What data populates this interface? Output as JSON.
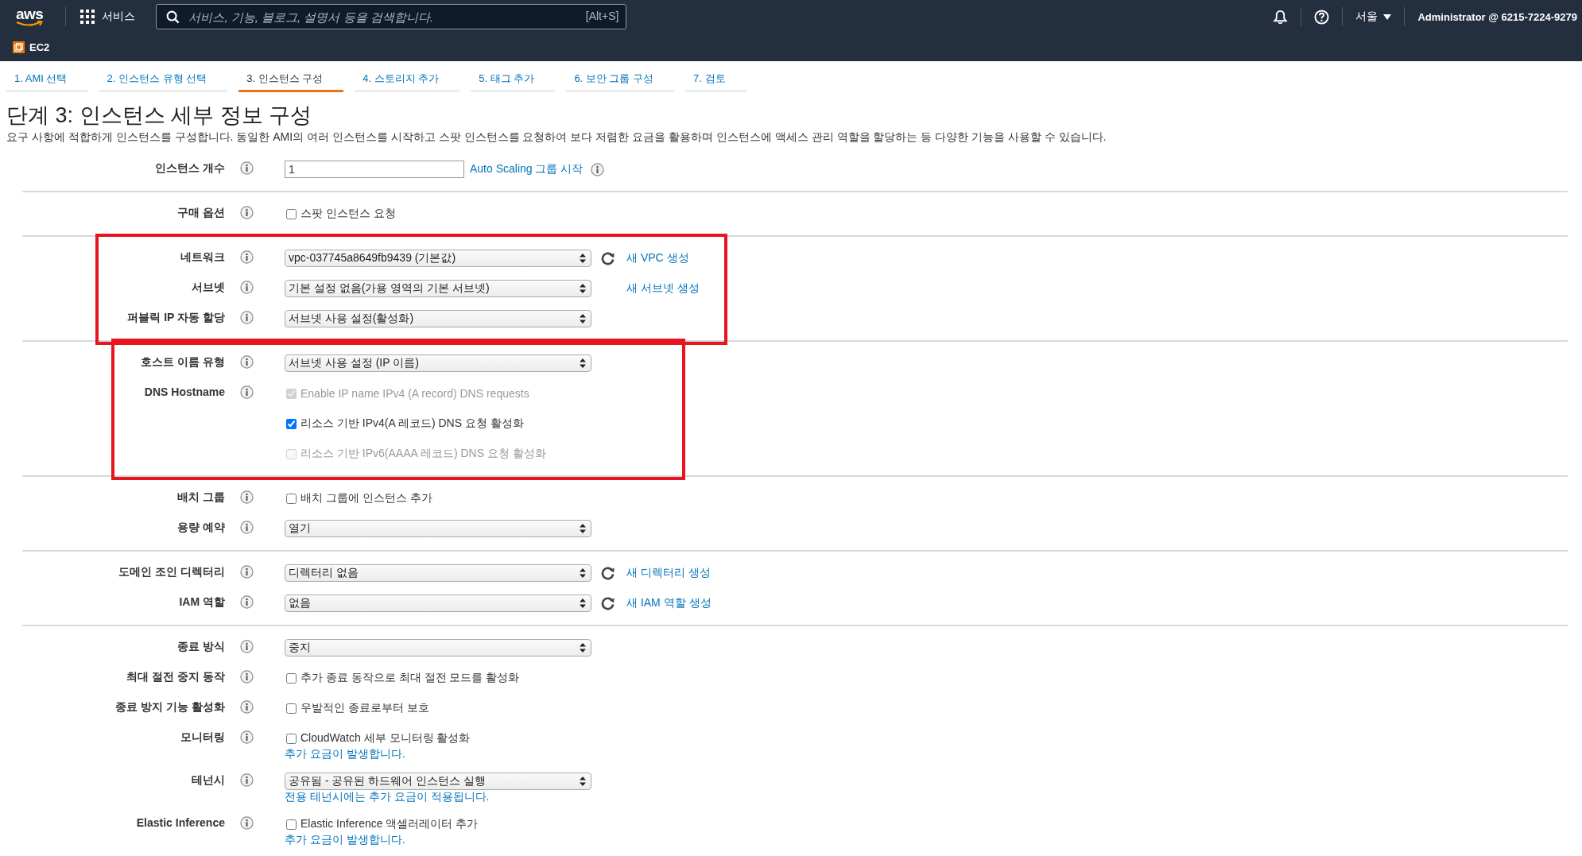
{
  "header": {
    "logo": "aws",
    "services": "서비스",
    "search": {
      "placeholder": "서비스, 기능, 블로그, 설명서 등을 검색합니다.",
      "shortcut": "[Alt+S]"
    },
    "region": "서울",
    "account": "Administrator @ 6215-7224-9279",
    "service": "EC2"
  },
  "tabs": [
    {
      "label": "1. AMI 선택",
      "selected": false
    },
    {
      "label": "2. 인스턴스 유형 선택",
      "selected": false
    },
    {
      "label": "3. 인스턴스 구성",
      "selected": true
    },
    {
      "label": "4. 스토리지 추가",
      "selected": false
    },
    {
      "label": "5. 태그 추가",
      "selected": false
    },
    {
      "label": "6. 보안 그룹 구성",
      "selected": false
    },
    {
      "label": "7. 검토",
      "selected": false
    }
  ],
  "title": "단계 3: 인스턴스 세부 정보 구성",
  "description": "요구 사항에 적합하게 인스턴스를 구성합니다. 동일한 AMI의 여러 인스턴스를 시작하고 스팟 인스턴스를 요청하여 보다 저렴한 요금을 활용하며 인스턴스에 액세스 관리 역할을 할당하는 등 다양한 기능을 사용할 수 있습니다.",
  "sections": [
    {
      "rows": [
        {
          "label": "인스턴스 개수",
          "lines": [
            {
              "kind": "input",
              "value": "1",
              "link": "Auto Scaling 그룹 시작",
              "link_info": true
            }
          ]
        }
      ]
    },
    {
      "rows": [
        {
          "label": "구매 옵션",
          "lines": [
            {
              "kind": "checkbox",
              "text": "스팟 인스턴스 요청",
              "checked": false,
              "disabled": false
            }
          ]
        }
      ]
    },
    {
      "highlighted": true,
      "rows": [
        {
          "label": "네트워크",
          "lines": [
            {
              "kind": "select",
              "value": "vpc-037745a8649fb9439 (기본값)",
              "refresh": true,
              "link": "새 VPC 생성"
            }
          ]
        },
        {
          "label": "서브넷",
          "lines": [
            {
              "kind": "select",
              "value": "기본 설정 없음(가용 영역의 기본 서브넷)",
              "link": "새 서브넷 생성"
            }
          ]
        },
        {
          "label": "퍼블릭 IP 자동 할당",
          "lines": [
            {
              "kind": "select",
              "value": "서브넷 사용 설정(활성화)"
            }
          ]
        }
      ]
    },
    {
      "highlighted": true,
      "rows": [
        {
          "label": "호스트 이름 유형",
          "lines": [
            {
              "kind": "select",
              "value": "서브넷 사용 설정 (IP 이름)"
            }
          ]
        },
        {
          "label": "DNS Hostname",
          "lines": [
            {
              "kind": "checkbox",
              "text": "Enable IP name IPv4 (A record) DNS requests",
              "checked": true,
              "disabled": true
            },
            {
              "kind": "checkbox",
              "text": "리소스 기반 IPv4(A 레코드) DNS 요청 활성화",
              "checked": true,
              "disabled": false
            },
            {
              "kind": "checkbox",
              "text": "리소스 기반 IPv6(AAAA 레코드) DNS 요청 활성화",
              "checked": false,
              "disabled": true
            }
          ]
        }
      ]
    },
    {
      "rows": [
        {
          "label": "배치 그룹",
          "lines": [
            {
              "kind": "checkbox",
              "text": "배치 그룹에 인스턴스 추가",
              "checked": false,
              "disabled": false
            }
          ]
        },
        {
          "label": "용량 예약",
          "lines": [
            {
              "kind": "select",
              "value": "열기"
            }
          ]
        }
      ]
    },
    {
      "rows": [
        {
          "label": "도메인 조인 디렉터리",
          "lines": [
            {
              "kind": "select",
              "value": "디렉터리 없음",
              "refresh": true,
              "link": "새 디렉터리 생성"
            }
          ]
        },
        {
          "label": "IAM 역할",
          "lines": [
            {
              "kind": "select",
              "value": "없음",
              "refresh": true,
              "link": "새 IAM 역할 생성"
            }
          ]
        }
      ]
    },
    {
      "rows": [
        {
          "label": "종료 방식",
          "lines": [
            {
              "kind": "select",
              "value": "중지"
            }
          ]
        },
        {
          "label": "최대 절전 중지 동작",
          "lines": [
            {
              "kind": "checkbox",
              "text": "추가 종료 동작으로 최대 절전 모드를 활성화",
              "checked": false,
              "disabled": false
            }
          ]
        },
        {
          "label": "종료 방지 기능 활성화",
          "lines": [
            {
              "kind": "checkbox",
              "text": "우발적인 종료로부터 보호",
              "checked": false,
              "disabled": false
            }
          ]
        },
        {
          "label": "모니터링",
          "lines": [
            {
              "kind": "checkbox",
              "text": "CloudWatch 세부 모니터링 활성화",
              "checked": false,
              "disabled": false
            },
            {
              "kind": "note",
              "text": "추가 요금이 발생합니다."
            }
          ]
        },
        {
          "label": "테넌시",
          "lines": [
            {
              "kind": "select",
              "value": "공유됨 - 공유된 하드웨어 인스턴스 실행"
            },
            {
              "kind": "note",
              "text": "전용 테넌시에는 추가 요금이 적용됩니다."
            }
          ]
        },
        {
          "label": "Elastic Inference",
          "lines": [
            {
              "kind": "checkbox",
              "text": "Elastic Inference 액셀러레이터 추가",
              "checked": false,
              "disabled": false
            },
            {
              "kind": "note",
              "text": "추가 요금이 발생합니다."
            }
          ]
        }
      ]
    }
  ]
}
